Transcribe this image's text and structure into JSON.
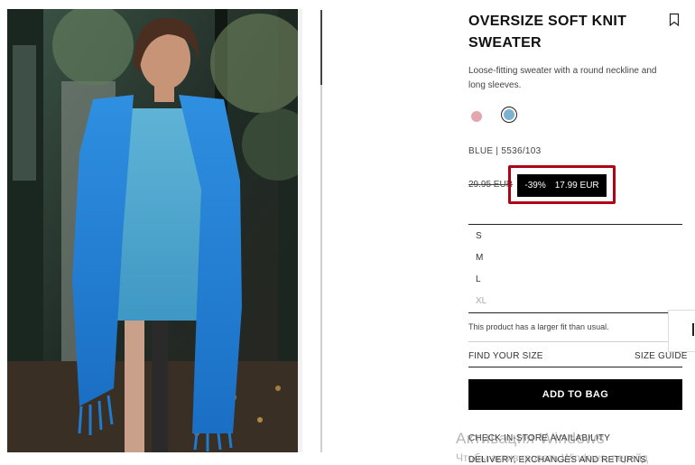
{
  "product": {
    "title": "OVERSIZE SOFT KNIT SWEATER",
    "description": "Loose-fitting sweater with a round neckline and long sleeves.",
    "color_code": "BLUE | 5536/103",
    "old_price": "29.95 EUR",
    "discount": "-39%",
    "price": "17.99 EUR",
    "swatch_colors": [
      "#e4a7ae",
      "#7ab2cf"
    ],
    "highlight_color": "#b00016"
  },
  "sizes": [
    {
      "label": "S",
      "available": true
    },
    {
      "label": "M",
      "available": true
    },
    {
      "label": "L",
      "available": true
    },
    {
      "label": "XL",
      "available": false
    }
  ],
  "fit_note": "This product has a larger fit than usual.",
  "links": {
    "find_size": "FIND YOUR SIZE",
    "size_guide": "SIZE GUIDE",
    "check_store": "CHECK IN-STORE AVAILABILITY",
    "delivery": "DELIVERY, EXCHANGES AND RETURNS"
  },
  "add_to_bag": "ADD TO BAG",
  "watermark": {
    "line1": "Активация Windows",
    "line2": "Чтобы активировать Windows, перейд"
  },
  "icons": {
    "bookmark": "bookmark-icon"
  }
}
